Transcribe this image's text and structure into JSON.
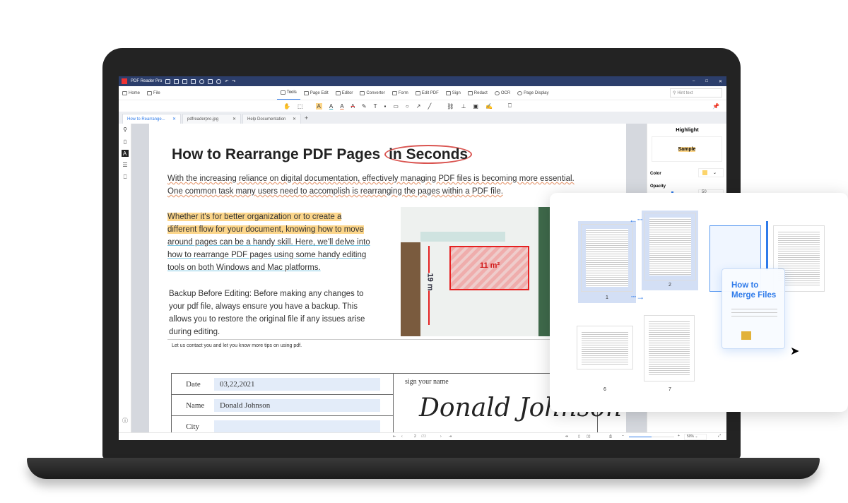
{
  "app": {
    "title": "PDF Reader Pro"
  },
  "menu": {
    "home": "Home",
    "file": "File",
    "items": [
      "Tools",
      "Page Edit",
      "Editor",
      "Converter",
      "Form",
      "Edit PDF",
      "Sign",
      "Redact",
      "OCR",
      "Page Display"
    ],
    "search_placeholder": "Hint text"
  },
  "tabs": [
    {
      "label": "How to Rearrange..."
    },
    {
      "label": "pdfreaderpro.jpg"
    },
    {
      "label": "Help Documentation"
    }
  ],
  "document": {
    "title_part1": "How to Rearrange PDF Pages ",
    "title_part2": "in Seconds",
    "intro": "With the increasing reliance on digital documentation, effectively managing PDF files is becoming more essential. One common task many users need to accomplish is rearranging the pages within a PDF file.",
    "para1_highlight": "Whether it's for better organization or to create a different flow for your document, knowing how to move",
    "para1_rest": "around pages can be a handy skill. Here, we'll delve into how to rearrange PDF pages using some handy editing tools on both Windows and Mac platforms.",
    "para2": "Backup Before Editing: Before making any changes to your pdf file, always ensure you have a backup. This allows you to restore the original file if any issues arise during editing.",
    "image_area_label": "11 m²",
    "image_height_label": "19 m",
    "contact_text": "Let us contact you and let you know more tips on using pdf.",
    "form": {
      "date_label": "Date",
      "date_value": "03,22,2021",
      "name_label": "Name",
      "name_value": "Donald Johnson",
      "city_label": "City",
      "city_value": "",
      "sign_label": "sign your name",
      "signature": "Donald Johnson"
    }
  },
  "right_panel": {
    "title": "Highlight",
    "sample": "Sample",
    "color_label": "Color",
    "opacity_label": "Opacity",
    "opacity_value": "50",
    "highlight_color": "#fcd46b",
    "opacity_fraction": 0.5
  },
  "status": {
    "current_page": "2",
    "total_pages": "/23",
    "zoom": "50%"
  },
  "popup": {
    "pages": [
      "1",
      "2",
      "6",
      "7"
    ],
    "merge_card_title": "How to Merge Files"
  },
  "colors": {
    "accent": "#2f7bea",
    "titlebar": "#2c3e6b",
    "highlight": "#fcd68b"
  }
}
